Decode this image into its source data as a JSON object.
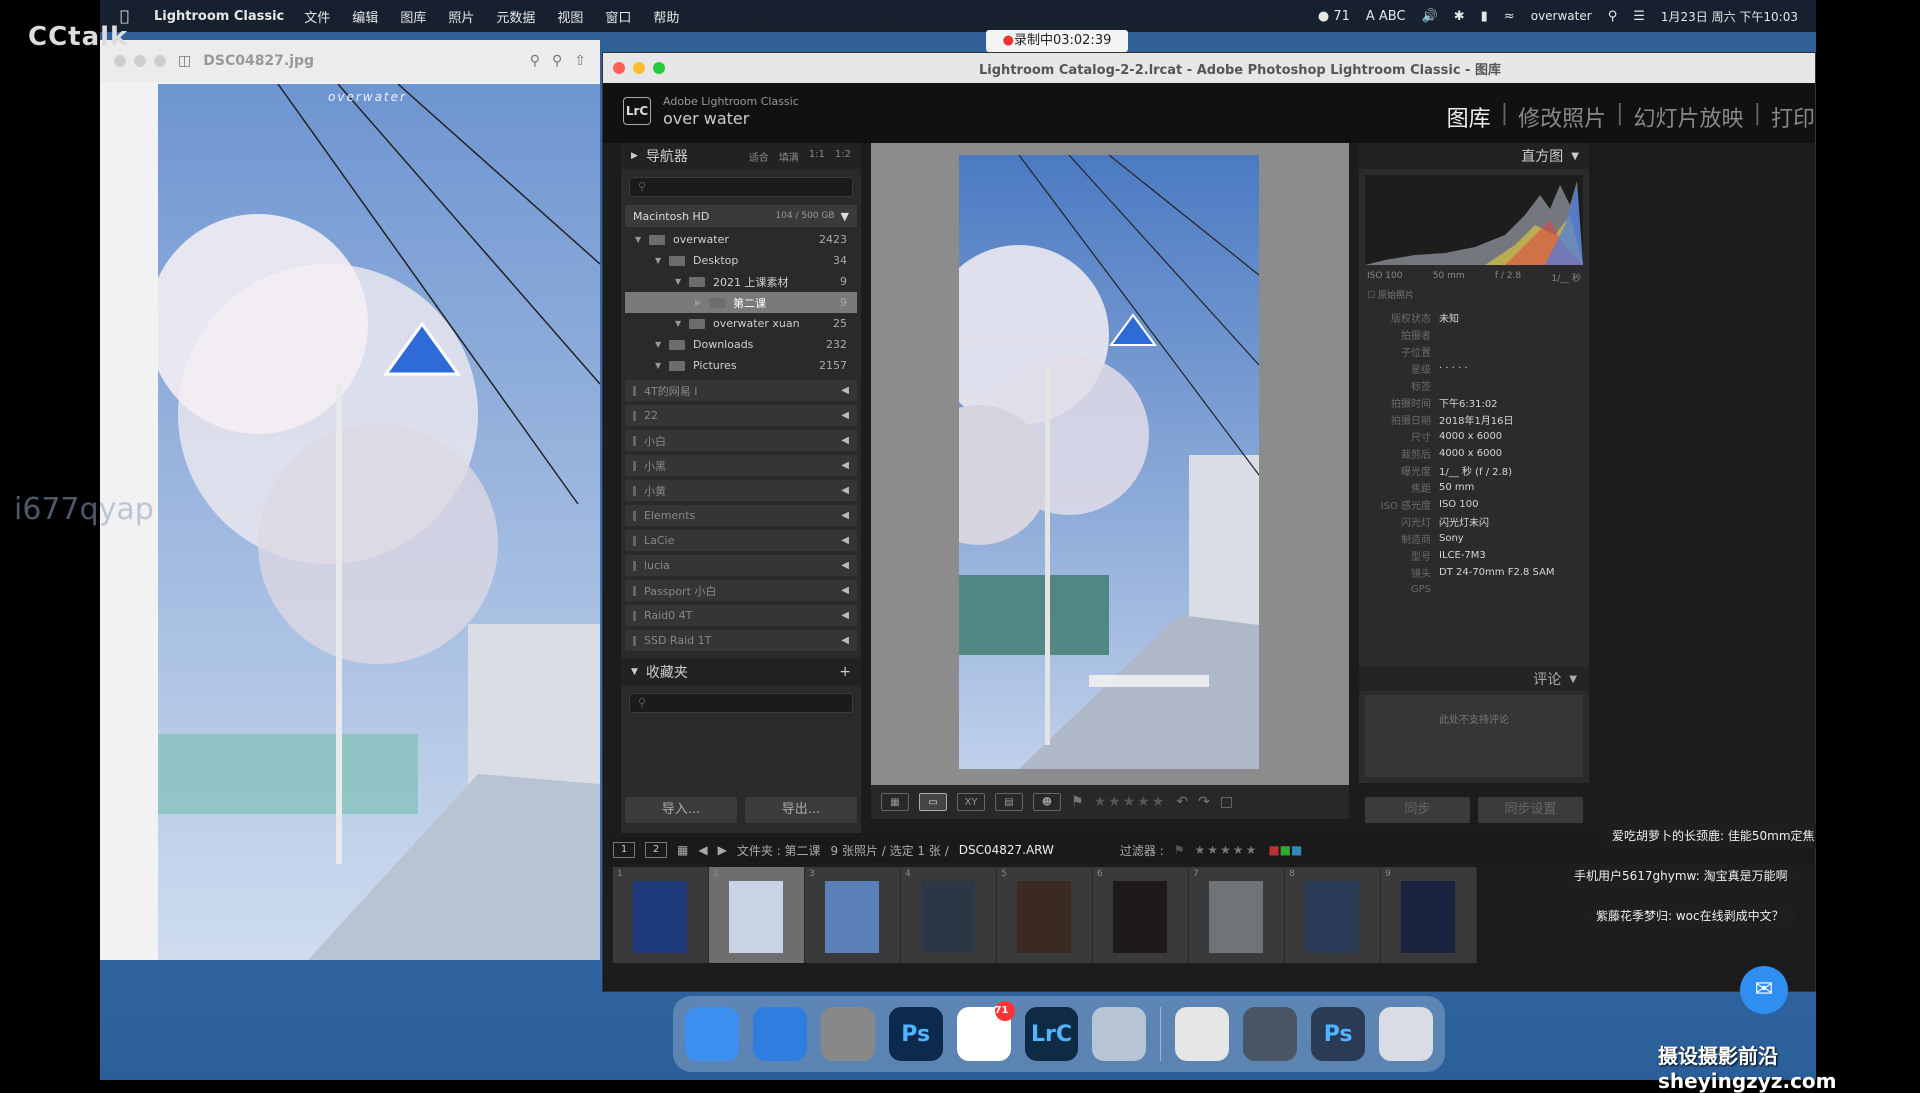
{
  "menubar": {
    "app_name": "Lightroom Classic",
    "menus": [
      "文件",
      "编辑",
      "图库",
      "照片",
      "元数据",
      "视图",
      "窗口",
      "帮助"
    ],
    "notification_count": "71",
    "input_method": "ABC",
    "user": "overwater",
    "datetime": "1月23日 周六 下午10:03"
  },
  "overlay": {
    "brand_text": "CCtalk",
    "watermark_text": "i677qyap",
    "recording": "录制中03:02:39",
    "site_watermark": "摄设摄影前沿sheyingzyz.com",
    "chat_messages": [
      "爱吃胡萝卜的长颈鹿: 佳能50mm定焦",
      "手机用户5617ghymw: 淘宝真是万能啊",
      "紫藤花季梦归: woc在线剥成中文？"
    ]
  },
  "preview": {
    "filename": "DSC04827.jpg",
    "photo_watermark": "overwater"
  },
  "lightroom": {
    "window_title": "Lightroom Catalog-2-2.lrcat - Adobe Photoshop Lightroom Classic - 图库",
    "logo": "LrC",
    "brand_line1": "Adobe Lightroom Classic",
    "brand_line2": "over water",
    "modules": [
      "图库",
      "修改照片",
      "幻灯片放映",
      "打印"
    ],
    "navigator": {
      "title": "导航器",
      "options": [
        "适合",
        "填满",
        "1:1",
        "1:2"
      ]
    },
    "volume": {
      "name": "Macintosh HD",
      "usage": "104 / 500 GB"
    },
    "folders": [
      {
        "name": "overwater",
        "count": "2423",
        "indent": 0
      },
      {
        "name": "Desktop",
        "count": "34",
        "indent": 1
      },
      {
        "name": "2021 上课素材",
        "count": "9",
        "indent": 2
      },
      {
        "name": "第二课",
        "count": "9",
        "indent": 3,
        "selected": true
      },
      {
        "name": "overwater xuan",
        "count": "25",
        "indent": 2
      },
      {
        "name": "Downloads",
        "count": "232",
        "indent": 1
      },
      {
        "name": "Pictures",
        "count": "2157",
        "indent": 1
      }
    ],
    "drives": [
      "4T的网易 I",
      "22",
      "小白",
      "小黑",
      "小黄",
      "Elements",
      "LaCie",
      "lucia",
      "Passport 小白",
      "Raid0 4T",
      "SSD Raid 1T"
    ],
    "collections_title": "收藏夹",
    "import_label": "导入...",
    "export_label": "导出...",
    "histogram": {
      "title": "直方图",
      "iso": "ISO 100",
      "focal": "50 mm",
      "aperture": "f / 2.8",
      "shutter": "1/__ 秒",
      "original_label": "原始照片"
    },
    "metadata": [
      {
        "label": "版权状态",
        "value": "未知"
      },
      {
        "label": "拍摄者",
        "value": ""
      },
      {
        "label": "子位置",
        "value": ""
      },
      {
        "label": "星级",
        "value": "· · · · ·"
      },
      {
        "label": "标签",
        "value": ""
      },
      {
        "label": "拍摄时间",
        "value": "下午6:31:02"
      },
      {
        "label": "拍摄日期",
        "value": "2018年1月16日"
      },
      {
        "label": "尺寸",
        "value": "4000 x 6000"
      },
      {
        "label": "裁剪后",
        "value": "4000 x 6000"
      },
      {
        "label": "曝光度",
        "value": "1/__ 秒 (f / 2.8)"
      },
      {
        "label": "焦距",
        "value": "50 mm"
      },
      {
        "label": "ISO 感光度",
        "value": "ISO 100"
      },
      {
        "label": "闪光灯",
        "value": "闪光灯未闪"
      },
      {
        "label": "制造商",
        "value": "Sony"
      },
      {
        "label": "型号",
        "value": "ILCE-7M3"
      },
      {
        "label": "镜头",
        "value": "DT 24-70mm F2.8 SAM"
      },
      {
        "label": "GPS",
        "value": ""
      }
    ],
    "comments_title": "评论",
    "comments_placeholder": "此处不支持评论",
    "sync_label": "同步",
    "sync_settings_label": "同步设置",
    "filmstrip_bar": {
      "pages": [
        "1",
        "2"
      ],
      "source": "文件夹 : 第二课",
      "count": "9 张照片 / 选定 1 张 /",
      "filename": "DSC04827.ARW",
      "filter_label": "过滤器 :"
    },
    "thumbnails": [
      {
        "num": "1",
        "tone": "#1f3a7a"
      },
      {
        "num": "2",
        "tone": "#c8d3e6",
        "selected": true
      },
      {
        "num": "3",
        "tone": "#5b7fb8"
      },
      {
        "num": "4",
        "tone": "#2c3746"
      },
      {
        "num": "5",
        "tone": "#3a2a22"
      },
      {
        "num": "6",
        "tone": "#1d1a19"
      },
      {
        "num": "7",
        "tone": "#6f7478"
      },
      {
        "num": "8",
        "tone": "#2b3c58"
      },
      {
        "num": "9",
        "tone": "#1a2440"
      }
    ]
  },
  "dock": {
    "items": [
      {
        "name": "finder",
        "label": "",
        "color": "#3d8ff0"
      },
      {
        "name": "safari",
        "label": "",
        "color": "#2f7de0"
      },
      {
        "name": "system-preferences",
        "label": "",
        "color": "#888888"
      },
      {
        "name": "photoshop",
        "label": "Ps",
        "color": "#0b2a4d"
      },
      {
        "name": "chrome",
        "label": "",
        "color": "#ffffff",
        "badge": "71"
      },
      {
        "name": "lightroom-classic",
        "label": "LrC",
        "color": "#0e2a44"
      },
      {
        "name": "preview",
        "label": "",
        "color": "#b7c4d6"
      },
      {
        "name": "downloads",
        "label": "",
        "color": "#e6e6e6"
      },
      {
        "name": "screenshot",
        "label": "",
        "color": "#4a5566"
      },
      {
        "name": "ps-document",
        "label": "Ps",
        "color": "#2a3b55"
      },
      {
        "name": "trash",
        "label": "",
        "color": "#d9dde3"
      }
    ]
  }
}
